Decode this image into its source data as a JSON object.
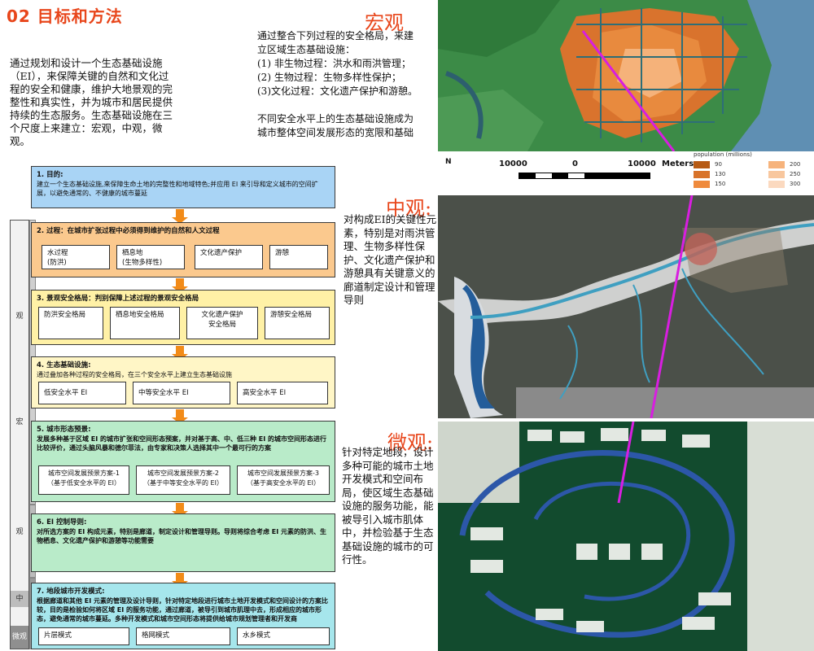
{
  "title": "02  目标和方法",
  "intro": "通过规划和设计一个生态基础设施（EI），来保障关键的自然和文化过程的安全和健康，维护大地景观的完整性和真实性，并为城市和居民提供持续的生态服务。生态基础设施在三个尺度上来建立：宏观，中观，微观。",
  "macro": {
    "heading": "宏观",
    "lines": [
      "通过整合下列过程的安全格局，来建",
      "立区域生态基础设施：",
      " (1) 非生物过程：洪水和雨洪管理；",
      " (2) 生物过程：生物多样性保护；",
      " (3)文化过程：文化遗产保护和游憩。",
      "",
      "不同安全水平上的生态基础设施成为",
      "城市整体空间发展形态的宽限和基础"
    ]
  },
  "meso": {
    "heading": "中观:",
    "text": "对构成EI的关键性元素，特别是对雨洪管理、生物多样性保护、文化遗产保护和游憩具有关键意义的廊道制定设计和管理导则"
  },
  "micro": {
    "heading": "微观:",
    "text": "针对特定地段，设计多种可能的城市土地开发模式和空间布局，使区域生态基础设施的服务功能，能被导引入城市肌体中，并检验基于生态基础设施的城市的可行性。"
  },
  "scale_labels": {
    "macro": "宏观",
    "meso": "中观",
    "micro": "微观",
    "seg1": "观",
    "seg2": "宏",
    "seg3": "观",
    "seg4": "中",
    "seg5": "微观"
  },
  "flow": {
    "s1_title": "1. 目的:",
    "s1_text": "建立一个生态基础设施,来保障生命土地的完整性和地域特色;并应用 EI 来引导和定义城市的空间扩展，以避免通常的、不健康的城市蔓延",
    "s2_title": "2. 过程：在城市扩张过程中必须得到维护的自然和人文过程",
    "s2_items": [
      "水过程\n(防洪)",
      "栖息地\n(生物多样性)",
      "文化遗产保护",
      "游憩"
    ],
    "s3_title": "3. 景观安全格局：判别保障上述过程的景观安全格局",
    "s3_items": [
      "防洪安全格局",
      "栖息地安全格局",
      "文化遗产保护\n安全格局",
      "游憩安全格局"
    ],
    "s4_title": "4. 生态基础设施:",
    "s4_text": "通过叠加各种过程的安全格局，在三个安全水平上建立生态基础设施",
    "s4_items": [
      "低安全水平 EI",
      "中等安全水平 EI",
      "高安全水平 EI"
    ],
    "s5_title": "5. 城市形态预景:",
    "s5_text": "发展多种基于区域 EI 的城市扩张和空间形态预案，并对基于高、中、低三种 EI 的城市空间形态进行比较评价，通过头脑风暴和德尔菲法，由专家和决策人选择其中一个最可行的方案",
    "s5_items": [
      "城市空间发展预景方案-1\n（基于低安全水平的 EI）",
      "城市空间发展预景方案-2\n（基于中等安全水平的 EI）",
      "城市空间发展预景方案-3\n（基于高安全水平的 EI）"
    ],
    "s6_title": "6. EI 控制导则:",
    "s6_text": "对所选方案的 EI 构成元素，特别是廊道，制定设计和管理导则。导则将综合考虑 EI 元素的防洪、生物栖息、文化遗产保护和游憩等功能需要",
    "s7_title": "7. 地段城市开发模式:",
    "s7_text": "根据廊道和其他 EI 元素的管理及设计导则，针对特定地段进行城市土地开发模式和空间设计的方案比较，目的是检验如何将区域 EI 的服务功能，通过廊道，被导引到城市肌理中去，形成相应的城市形态，避免通常的城市蔓延。多种开发模式和城市空间形态将提供给城市规划管理者和开发商",
    "s7_items": [
      "片层模式",
      "格网模式",
      "水乡模式"
    ]
  },
  "map_macro": {
    "scale_labels": [
      "10000",
      "0",
      "10000",
      "Meters"
    ],
    "north": "N",
    "legend_title": "population (millions)",
    "legend": [
      {
        "label": "90",
        "color": "#b65a14"
      },
      {
        "label": "200",
        "color": "#f6b37c"
      },
      {
        "label": "130",
        "color": "#d8732a"
      },
      {
        "label": "250",
        "color": "#f8c79e"
      },
      {
        "label": "150",
        "color": "#ef8a3c"
      },
      {
        "label": "300",
        "color": "#fbd9bf"
      }
    ]
  },
  "colors": {
    "accent": "#e8461b",
    "magenta_line": "#d81ee0",
    "arrow": "#f28b18"
  }
}
